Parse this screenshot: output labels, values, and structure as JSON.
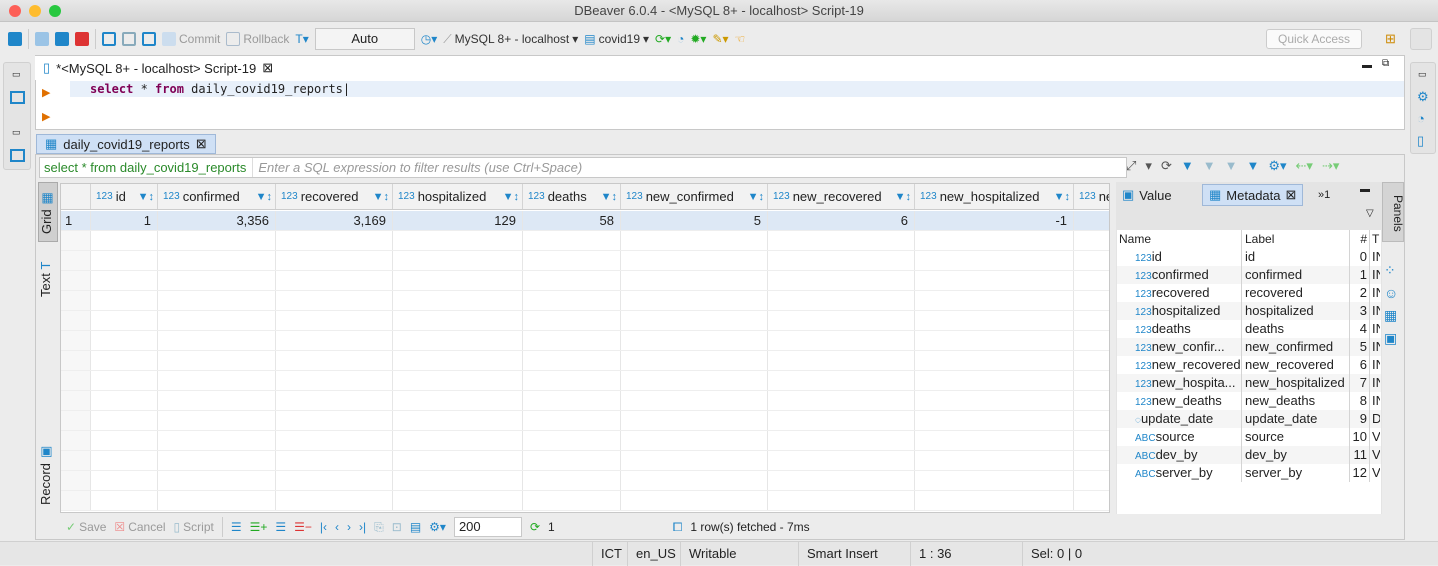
{
  "window": {
    "title": "DBeaver 6.0.4 - <MySQL 8+ - localhost> Script-19"
  },
  "toolbar": {
    "commit": "Commit",
    "rollback": "Rollback",
    "transaction_mode": "Auto",
    "connection": "MySQL 8+ - localhost",
    "database": "covid19",
    "quick_access": "Quick Access"
  },
  "editor": {
    "tab_title": "*<MySQL 8+ - localhost> Script-19",
    "sql": {
      "select": "select",
      "star": " * ",
      "from": "from",
      "table": " daily_covid19_reports"
    }
  },
  "results": {
    "tab_title": "daily_covid19_reports",
    "filter_query": "select * from daily_covid19_reports",
    "filter_placeholder": "Enter a SQL expression to filter results (use Ctrl+Space)",
    "side_tabs": [
      "Grid",
      "Text",
      "Record"
    ],
    "columns": [
      "id",
      "confirmed",
      "recovered",
      "hospitalized",
      "deaths",
      "new_confirmed",
      "new_recovered",
      "new_hospitalized",
      "ne"
    ],
    "rows": [
      {
        "num": "1",
        "cells": [
          "1",
          "3,356",
          "3,169",
          "129",
          "58",
          "5",
          "6",
          "-1",
          ""
        ]
      }
    ]
  },
  "metadata": {
    "tabs": {
      "value": "Value",
      "metadata": "Metadata",
      "more": "»1"
    },
    "panels_label": "Panels",
    "headers": [
      "Name",
      "Label",
      "#",
      "T"
    ],
    "rows": [
      {
        "type": "123",
        "name": "id",
        "label": "id",
        "pos": "0",
        "t": "IN"
      },
      {
        "type": "123",
        "name": "confirmed",
        "label": "confirmed",
        "pos": "1",
        "t": "IN"
      },
      {
        "type": "123",
        "name": "recovered",
        "label": "recovered",
        "pos": "2",
        "t": "IN"
      },
      {
        "type": "123",
        "name": "hospitalized",
        "label": "hospitalized",
        "pos": "3",
        "t": "IN"
      },
      {
        "type": "123",
        "name": "deaths",
        "label": "deaths",
        "pos": "4",
        "t": "IN"
      },
      {
        "type": "123",
        "name": "new_confir...",
        "label": "new_confirmed",
        "pos": "5",
        "t": "IN"
      },
      {
        "type": "123",
        "name": "new_recovered",
        "label": "new_recovered",
        "pos": "6",
        "t": "IN"
      },
      {
        "type": "123",
        "name": "new_hospita...",
        "label": "new_hospitalized",
        "pos": "7",
        "t": "IN"
      },
      {
        "type": "123",
        "name": "new_deaths",
        "label": "new_deaths",
        "pos": "8",
        "t": "IN"
      },
      {
        "type": "date",
        "name": "update_date",
        "label": "update_date",
        "pos": "9",
        "t": "D"
      },
      {
        "type": "ABC",
        "name": "source",
        "label": "source",
        "pos": "10",
        "t": "V"
      },
      {
        "type": "ABC",
        "name": "dev_by",
        "label": "dev_by",
        "pos": "11",
        "t": "V"
      },
      {
        "type": "ABC",
        "name": "server_by",
        "label": "server_by",
        "pos": "12",
        "t": "V"
      }
    ]
  },
  "bottom": {
    "save": "Save",
    "cancel": "Cancel",
    "script": "Script",
    "fetch_size": "200",
    "refresh_count": "1",
    "fetch_status": "1 row(s) fetched - 7ms"
  },
  "status": {
    "timezone": "ICT",
    "locale": "en_US",
    "mode": "Writable",
    "insert": "Smart Insert",
    "position": "1 : 36",
    "selection": "Sel: 0 | 0"
  },
  "colors": {
    "accent": "#1f86c9",
    "keyword": "#7f0055",
    "filter_query": "#2a8a2a"
  }
}
